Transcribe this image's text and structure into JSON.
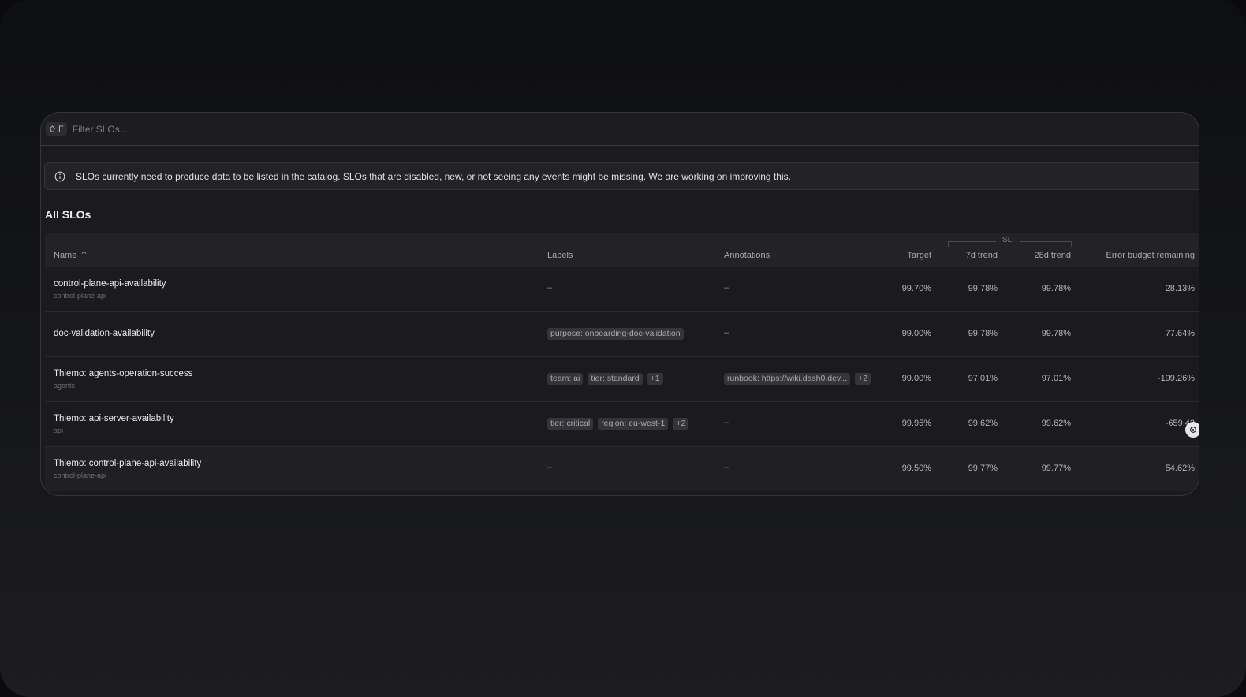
{
  "filter": {
    "shortcut": "F",
    "placeholder": "Filter SLOs..."
  },
  "banner": {
    "icon": "info-icon",
    "text": "SLOs currently need to produce data to be listed in the catalog. SLOs that are disabled, new, or not seeing any events might be missing. We are working on improving this."
  },
  "section_title": "All SLOs",
  "table": {
    "group_header": "SLI",
    "columns": {
      "name": "Name",
      "labels": "Labels",
      "annotations": "Annotations",
      "target": "Target",
      "trend7d": "7d trend",
      "trend28d": "28d trend",
      "budget": "Error budget remaining"
    },
    "rows": [
      {
        "name": "control-plane-api-availability",
        "sub": "control-plane-api",
        "labels": [],
        "labels_empty": "–",
        "annotations": [],
        "annotations_empty": "–",
        "target": "99.70%",
        "trend7d": "99.78%",
        "trend28d": "99.78%",
        "budget": "28.13%"
      },
      {
        "name": "doc-validation-availability",
        "sub": "",
        "labels": [
          "purpose: onboarding-doc-validation"
        ],
        "annotations": [],
        "annotations_empty": "–",
        "target": "99.00%",
        "trend7d": "99.78%",
        "trend28d": "99.78%",
        "budget": "77.64%"
      },
      {
        "name": "Thiemo: agents-operation-success",
        "sub": "agents",
        "labels": [
          "team: ai",
          "tier: standard",
          "+1"
        ],
        "annotations": [
          "runbook: https://wiki.dash0.dev...",
          "+2"
        ],
        "target": "99.00%",
        "trend7d": "97.01%",
        "trend28d": "97.01%",
        "budget": "-199.26%"
      },
      {
        "name": "Thiemo: api-server-availability",
        "sub": "api",
        "labels": [
          "tier: critical",
          "region: eu-west-1",
          "+2"
        ],
        "annotations": [],
        "annotations_empty": "–",
        "target": "99.95%",
        "trend7d": "99.62%",
        "trend28d": "99.62%",
        "budget": "-659.42"
      },
      {
        "name": "Thiemo: control-plane-api-availability",
        "sub": "control-plane-api",
        "labels": [],
        "labels_empty": "–",
        "annotations": [],
        "annotations_empty": "–",
        "target": "99.50%",
        "trend7d": "99.77%",
        "trend28d": "99.77%",
        "budget": "54.62%"
      }
    ]
  }
}
